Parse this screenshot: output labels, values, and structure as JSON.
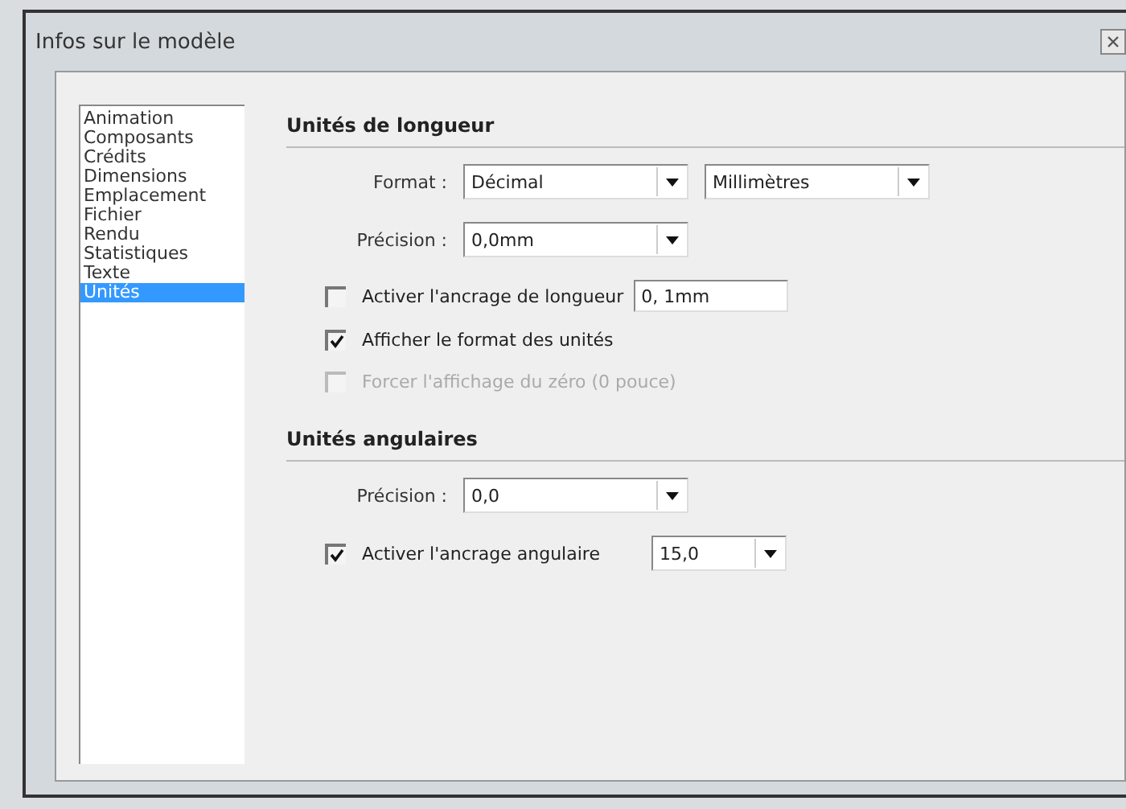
{
  "window": {
    "title": "Infos sur le modèle"
  },
  "sidebar": {
    "items": [
      {
        "label": "Animation",
        "selected": false
      },
      {
        "label": "Composants",
        "selected": false
      },
      {
        "label": "Crédits",
        "selected": false
      },
      {
        "label": "Dimensions",
        "selected": false
      },
      {
        "label": "Emplacement",
        "selected": false
      },
      {
        "label": "Fichier",
        "selected": false
      },
      {
        "label": "Rendu",
        "selected": false
      },
      {
        "label": "Statistiques",
        "selected": false
      },
      {
        "label": "Texte",
        "selected": false
      },
      {
        "label": "Unités",
        "selected": true
      }
    ]
  },
  "sections": [
    {
      "title": "Unités de longueur",
      "rows": [
        {
          "kind": "select",
          "label": "Format :",
          "selects": [
            "Décimal",
            "Millimètres"
          ]
        },
        {
          "kind": "select",
          "label": "Précision :",
          "selects": [
            "0,0mm"
          ]
        },
        {
          "kind": "check",
          "label": "Activer l'ancrage de longueur",
          "checked": false,
          "disabled": false,
          "field": {
            "kind": "input",
            "value": "0, 1mm"
          }
        },
        {
          "kind": "check",
          "label": "Afficher le format des unités",
          "checked": true,
          "disabled": false
        },
        {
          "kind": "check",
          "label": "Forcer l'affichage du zéro (0 pouce)",
          "checked": false,
          "disabled": true
        }
      ]
    },
    {
      "title": "Unités angulaires",
      "rows": [
        {
          "kind": "select",
          "label": "Précision :",
          "selects": [
            "0,0"
          ]
        },
        {
          "kind": "check",
          "label": "Activer l'ancrage angulaire",
          "checked": true,
          "disabled": false,
          "field": {
            "kind": "select",
            "value": "15,0"
          }
        }
      ]
    }
  ]
}
